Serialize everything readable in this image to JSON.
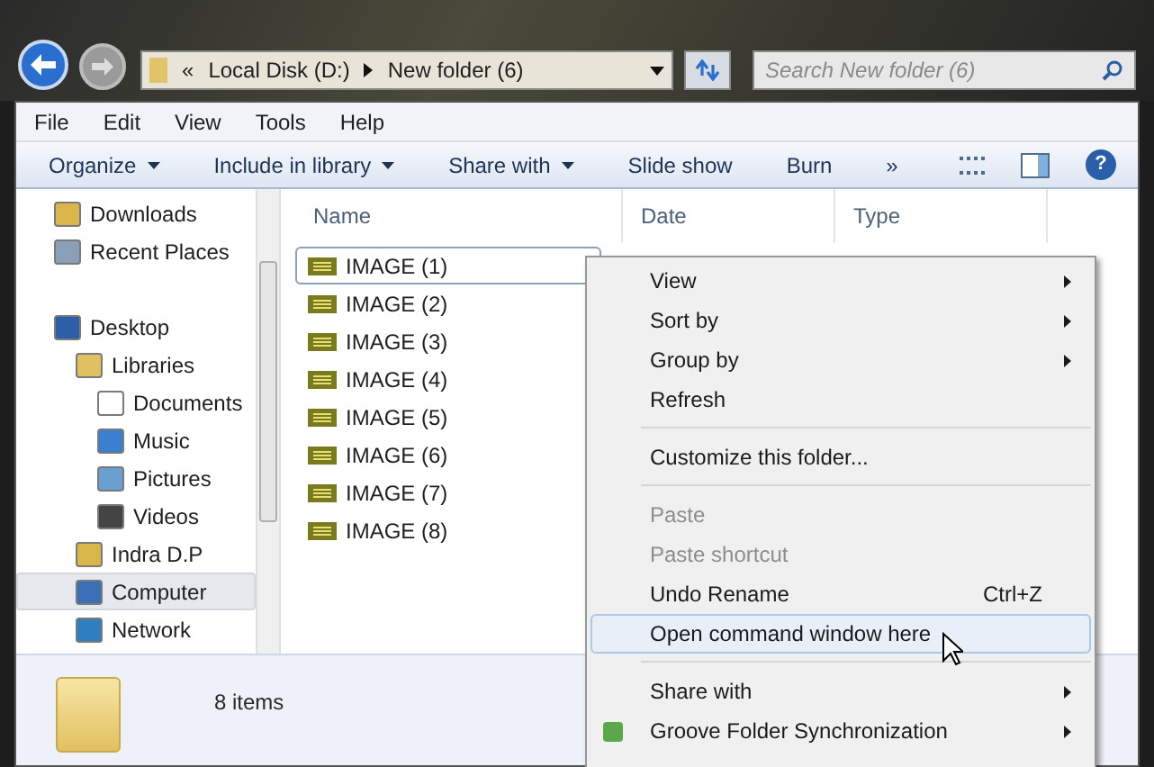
{
  "address_bar": {
    "overflow": "«",
    "segments": [
      "Local Disk (D:)",
      "New folder (6)"
    ]
  },
  "search": {
    "placeholder": "Search New folder (6)"
  },
  "menu_bar": [
    "File",
    "Edit",
    "View",
    "Tools",
    "Help"
  ],
  "toolbar": [
    {
      "label": "Organize",
      "dropdown": true
    },
    {
      "label": "Include in library",
      "dropdown": true
    },
    {
      "label": "Share with",
      "dropdown": true
    },
    {
      "label": "Slide show",
      "dropdown": false
    },
    {
      "label": "Burn",
      "dropdown": false
    },
    {
      "label": "»",
      "dropdown": false
    }
  ],
  "help": "?",
  "sidebar": {
    "items": [
      {
        "label": "Downloads",
        "selected": false
      },
      {
        "label": "Recent Places",
        "selected": false
      },
      {
        "label": "Desktop",
        "selected": false,
        "children": [
          {
            "label": "Libraries",
            "selected": false,
            "children": [
              {
                "label": "Documents",
                "selected": false
              },
              {
                "label": "Music",
                "selected": false
              },
              {
                "label": "Pictures",
                "selected": false
              },
              {
                "label": "Videos",
                "selected": false
              }
            ]
          },
          {
            "label": "Indra D.P",
            "selected": false
          },
          {
            "label": "Computer",
            "selected": true
          },
          {
            "label": "Network",
            "selected": false
          }
        ]
      }
    ]
  },
  "file_list": {
    "columns": [
      "Name",
      "Date",
      "Type"
    ],
    "files": [
      {
        "name": "IMAGE (1)",
        "selected": true
      },
      {
        "name": "IMAGE (2)",
        "selected": false
      },
      {
        "name": "IMAGE (3)",
        "selected": false
      },
      {
        "name": "IMAGE (4)",
        "selected": false
      },
      {
        "name": "IMAGE (5)",
        "selected": false
      },
      {
        "name": "IMAGE (6)",
        "selected": false
      },
      {
        "name": "IMAGE (7)",
        "selected": false
      },
      {
        "name": "IMAGE (8)",
        "selected": false
      }
    ]
  },
  "status_bar": {
    "count": "8 items"
  },
  "context_menu": [
    {
      "kind": "item",
      "label": "View",
      "submenu": true,
      "disabled": false,
      "selected": false
    },
    {
      "kind": "item",
      "label": "Sort by",
      "submenu": true,
      "disabled": false,
      "selected": false
    },
    {
      "kind": "item",
      "label": "Group by",
      "submenu": true,
      "disabled": false,
      "selected": false
    },
    {
      "kind": "item",
      "label": "Refresh",
      "submenu": false,
      "disabled": false,
      "selected": false
    },
    {
      "kind": "separator"
    },
    {
      "kind": "item",
      "label": "Customize this folder...",
      "submenu": false,
      "disabled": false,
      "selected": false
    },
    {
      "kind": "separator"
    },
    {
      "kind": "item",
      "label": "Paste",
      "submenu": false,
      "disabled": true,
      "selected": false
    },
    {
      "kind": "item",
      "label": "Paste shortcut",
      "submenu": false,
      "disabled": true,
      "selected": false
    },
    {
      "kind": "item",
      "label": "Undo Rename",
      "shortcut": "Ctrl+Z",
      "submenu": false,
      "disabled": false,
      "selected": false
    },
    {
      "kind": "item",
      "label": "Open command window here",
      "submenu": false,
      "disabled": false,
      "selected": true
    },
    {
      "kind": "separator"
    },
    {
      "kind": "item",
      "label": "Share with",
      "submenu": true,
      "disabled": false,
      "selected": false
    },
    {
      "kind": "item",
      "label": "Groove Folder Synchronization",
      "submenu": true,
      "disabled": false,
      "selected": false
    }
  ]
}
